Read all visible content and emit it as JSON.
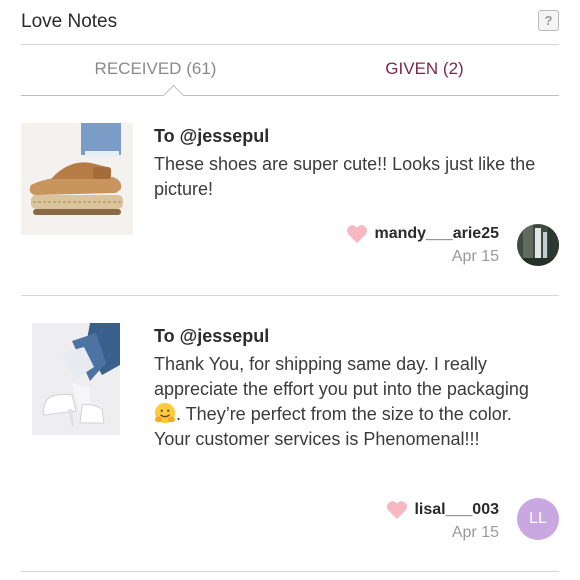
{
  "header": {
    "title": "Love Notes",
    "help_label": "?"
  },
  "tabs": [
    {
      "label": "RECEIVED",
      "count": "(61)"
    },
    {
      "label": "GIVEN",
      "count": "(2)"
    }
  ],
  "notes": [
    {
      "to": "To @jessepul",
      "text": "These shoes are super cute!! Looks just like the picture!",
      "username": "mandy___arie25",
      "date": "Apr 15",
      "avatar_initials": ""
    },
    {
      "to": "To @jessepul",
      "text_before_emoji": "Thank You, for shipping same day. I really appreciate the effort you put into the packaging",
      "text_after_emoji": ". They’re perfect from the size to the color. Your customer services is Phenomenal!!!",
      "username": "lisal___003",
      "date": "Apr 15",
      "avatar_initials": "LL"
    }
  ]
}
